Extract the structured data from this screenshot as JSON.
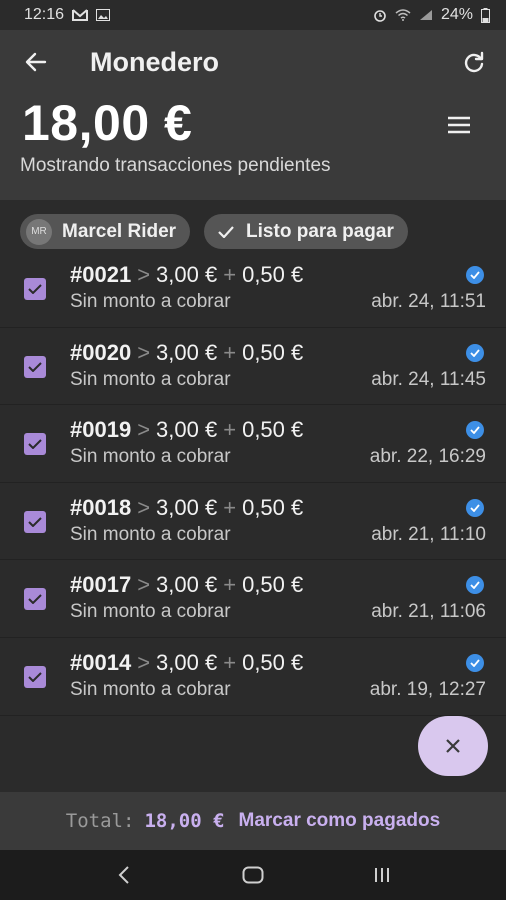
{
  "status_bar": {
    "time": "12:16",
    "battery": "24%"
  },
  "header": {
    "title": "Monedero",
    "amount": "18,00 €",
    "subtitle": "Mostrando transacciones pendientes"
  },
  "filters": {
    "rider_initials": "MR",
    "rider_name": "Marcel Rider",
    "status_label": "Listo para pagar"
  },
  "transactions": [
    {
      "id": "#0021",
      "amount": "3,00 €",
      "extra": "0,50 €",
      "note": "Sin monto a cobrar",
      "date": "abr. 24, 11:51"
    },
    {
      "id": "#0020",
      "amount": "3,00 €",
      "extra": "0,50 €",
      "note": "Sin monto a cobrar",
      "date": "abr. 24, 11:45"
    },
    {
      "id": "#0019",
      "amount": "3,00 €",
      "extra": "0,50 €",
      "note": "Sin monto a cobrar",
      "date": "abr. 22, 16:29"
    },
    {
      "id": "#0018",
      "amount": "3,00 €",
      "extra": "0,50 €",
      "note": "Sin monto a cobrar",
      "date": "abr. 21, 11:10"
    },
    {
      "id": "#0017",
      "amount": "3,00 €",
      "extra": "0,50 €",
      "note": "Sin monto a cobrar",
      "date": "abr. 21, 11:06"
    },
    {
      "id": "#0014",
      "amount": "3,00 €",
      "extra": "0,50 €",
      "note": "Sin monto a cobrar",
      "date": "abr. 19, 12:27"
    }
  ],
  "symbols": {
    "chevron": ">",
    "plus": "+"
  },
  "footer": {
    "total_label": "Total:",
    "total_value": "18,00 €",
    "action_label": "Marcar como pagados"
  },
  "colors": {
    "accent": "#c9b0ef",
    "checkbox": "#a98ad8",
    "verified": "#3d8fe6",
    "fab": "#d9c8ee"
  },
  "icons": [
    "back-arrow-icon",
    "refresh-icon",
    "menu-icon",
    "check-icon",
    "checkbox-checked-icon",
    "verified-icon",
    "close-icon"
  ]
}
